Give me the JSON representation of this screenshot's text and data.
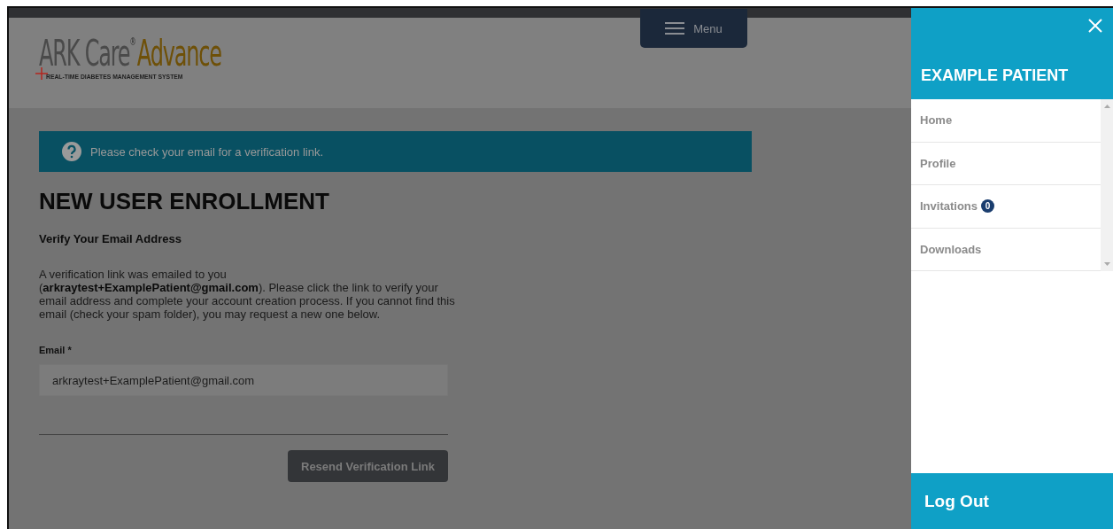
{
  "logo": {
    "brand": "ARK Care",
    "mark": "®",
    "product": "Advance",
    "tagline": "REAL-TIME DIABETES MANAGEMENT SYSTEM"
  },
  "menu_button": {
    "label": "Menu"
  },
  "alert": {
    "text": "Please check your email for a verification link."
  },
  "page": {
    "title": "NEW USER ENROLLMENT",
    "subtitle": "Verify Your Email Address",
    "message": "A verification link was emailed to you (**arkraytest+ExamplePatient@gmail.com**). Please click the link to verify your email address and complete your account creation process. If you cannot find this email (check your spam folder), you may request a new one below."
  },
  "form": {
    "label": "Email *",
    "value": "arkraytest+ExamplePatient@gmail.com",
    "button": "Resend Verification Link"
  },
  "drawer": {
    "title": "EXAMPLE PATIENT",
    "items": [
      {
        "label": "Home"
      },
      {
        "label": "Profile"
      },
      {
        "label": "Invitations",
        "badge": "0"
      },
      {
        "label": "Downloads"
      }
    ],
    "logout": "Log Out"
  }
}
